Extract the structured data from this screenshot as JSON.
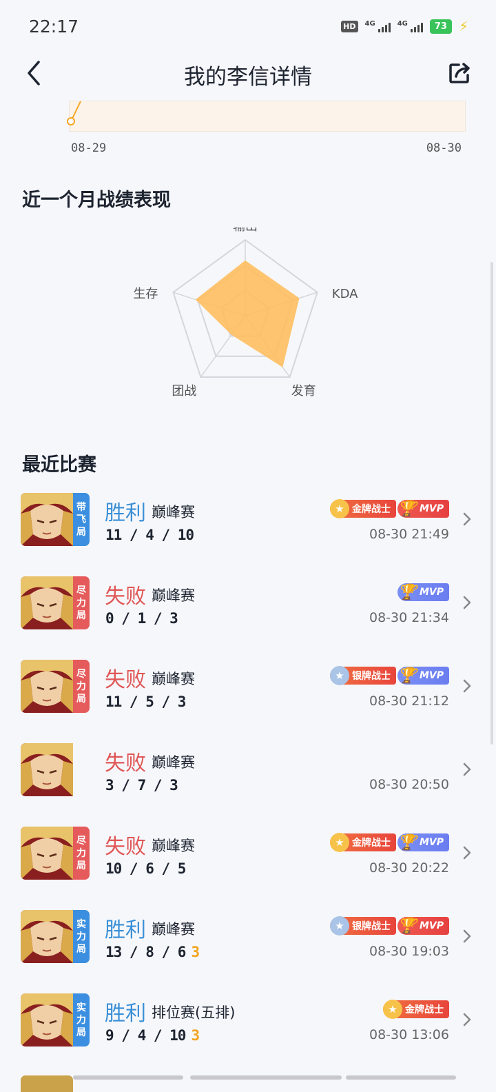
{
  "status": {
    "time": "22:17",
    "battery": "73",
    "hd_label": "HD",
    "net1": "4G",
    "net2": "4G"
  },
  "nav": {
    "title": "我的李信详情"
  },
  "trend": {
    "start_date": "08-29",
    "end_date": "08-30"
  },
  "performance": {
    "title": "近一个月战绩表现",
    "radar_labels": [
      "输出",
      "KDA",
      "发育",
      "团战",
      "生存"
    ],
    "radar_values": [
      0.73,
      0.75,
      0.84,
      0.31,
      0.69
    ],
    "fill_color": "#ffbd5c"
  },
  "recent": {
    "title": "最近比赛",
    "matches": [
      {
        "tag": [
          "带",
          "飞",
          "局"
        ],
        "tag_color": "blue",
        "result": "胜利",
        "win": true,
        "mode": "巅峰赛",
        "kda": "11 / 4 / 10",
        "streak": "",
        "badges": [
          "gold",
          "mvp-gold"
        ],
        "time": "08-30 21:49"
      },
      {
        "tag": [
          "尽",
          "力",
          "局"
        ],
        "tag_color": "red",
        "result": "失败",
        "win": false,
        "mode": "巅峰赛",
        "kda": "0 / 1 / 3",
        "streak": "",
        "badges": [
          "mvp-blue"
        ],
        "time": "08-30 21:34"
      },
      {
        "tag": [
          "尽",
          "力",
          "局"
        ],
        "tag_color": "red",
        "result": "失败",
        "win": false,
        "mode": "巅峰赛",
        "kda": "11 / 5 / 3",
        "streak": "",
        "badges": [
          "silver",
          "mvp-blue"
        ],
        "time": "08-30 21:12"
      },
      {
        "tag": [],
        "tag_color": "none",
        "result": "失败",
        "win": false,
        "mode": "巅峰赛",
        "kda": "3 / 7 / 3",
        "streak": "",
        "badges": [],
        "time": "08-30 20:50"
      },
      {
        "tag": [
          "尽",
          "力",
          "局"
        ],
        "tag_color": "red",
        "result": "失败",
        "win": false,
        "mode": "巅峰赛",
        "kda": "10 / 6 / 5",
        "streak": "",
        "badges": [
          "gold",
          "mvp-blue"
        ],
        "time": "08-30 20:22"
      },
      {
        "tag": [
          "实",
          "力",
          "局"
        ],
        "tag_color": "blue",
        "result": "胜利",
        "win": true,
        "mode": "巅峰赛",
        "kda": "13 / 8 / 6",
        "streak": "3",
        "badges": [
          "silver",
          "mvp-gold"
        ],
        "time": "08-30 19:03"
      },
      {
        "tag": [
          "实",
          "力",
          "局"
        ],
        "tag_color": "blue",
        "result": "胜利",
        "win": true,
        "mode": "排位赛(五排)",
        "kda": "9 / 4 / 10",
        "streak": "3",
        "badges": [
          "gold"
        ],
        "time": "08-30 13:06"
      }
    ]
  },
  "badge_labels": {
    "gold": "金牌战士",
    "silver": "银牌战士",
    "mvp": "MVP"
  }
}
